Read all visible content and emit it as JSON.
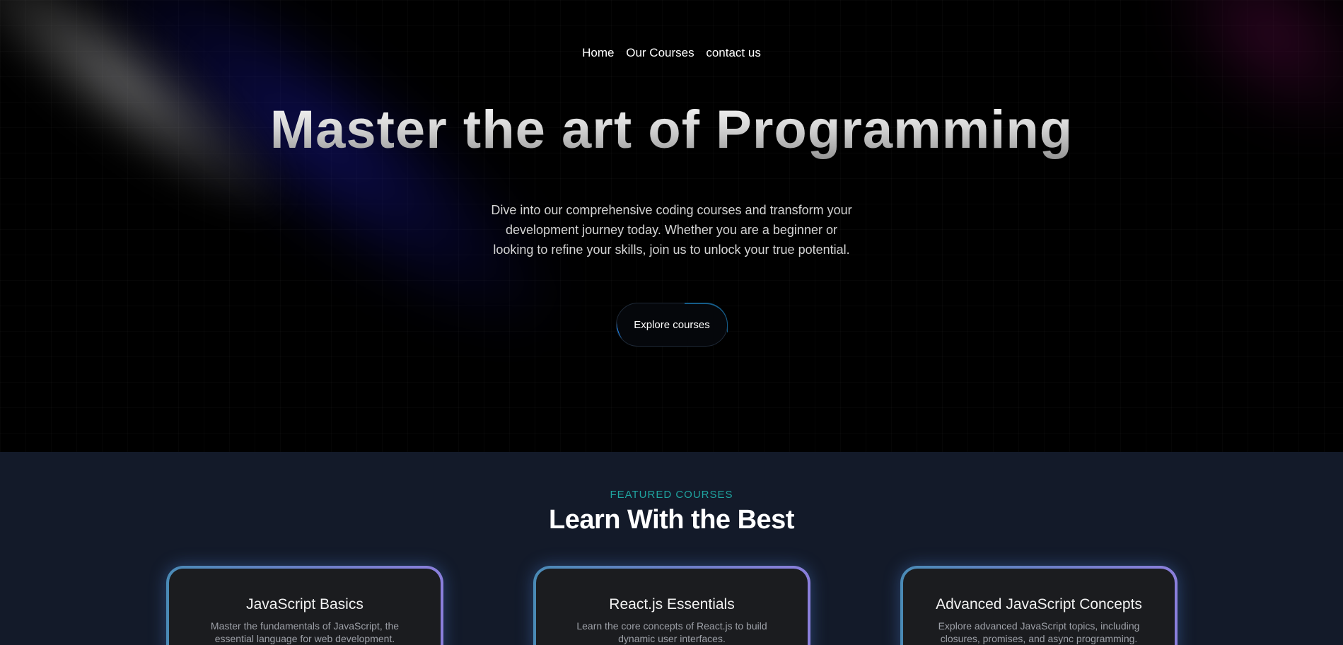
{
  "nav": {
    "items": [
      {
        "label": "Home"
      },
      {
        "label": "Our Courses"
      },
      {
        "label": "contact us"
      }
    ]
  },
  "hero": {
    "title": "Master the art of Programming",
    "description": "Dive into our comprehensive coding courses and transform your development journey today. Whether you are a beginner or looking to refine your skills, join us to unlock your true potential.",
    "cta_label": "Explore courses"
  },
  "featured": {
    "eyebrow": "FEATURED COURSES",
    "title": "Learn With the Best",
    "cards": [
      {
        "title": "JavaScript Basics",
        "description": "Master the fundamentals of JavaScript, the essential language for web development."
      },
      {
        "title": "React.js Essentials",
        "description": "Learn the core concepts of React.js to build dynamic user interfaces."
      },
      {
        "title": "Advanced JavaScript Concepts",
        "description": "Explore advanced JavaScript topics, including closures, promises, and async programming."
      }
    ]
  },
  "colors": {
    "hero_background": "#000000",
    "section_background": "#131a29",
    "accent_teal": "#1fa4a0",
    "card_border_start": "#4a8ab6",
    "card_border_end": "#8b7fdc"
  }
}
